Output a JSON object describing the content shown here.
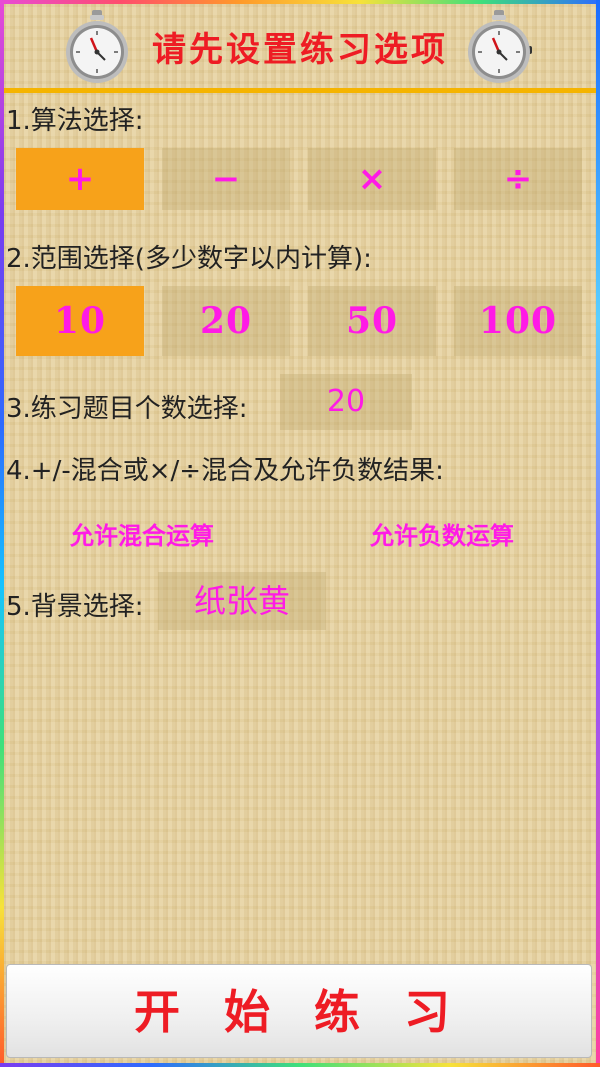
{
  "header": {
    "title": "请先设置练习选项",
    "left_icon": "stopwatch-icon",
    "right_icon": "stopwatch-icon"
  },
  "sections": {
    "operation": {
      "label": "1.算法选择:",
      "options": [
        "+",
        "−",
        "×",
        "÷"
      ],
      "selected": "+"
    },
    "range": {
      "label": "2.范围选择(多少数字以内计算):",
      "options": [
        "10",
        "20",
        "50",
        "100"
      ],
      "selected": "10"
    },
    "count": {
      "label": "3.练习题目个数选择:",
      "value": "20"
    },
    "mixed": {
      "label": "4.+/-混合或×/÷混合及允许负数结果:",
      "allow_mixed": "允许混合运算",
      "allow_negative": "允许负数运算"
    },
    "background": {
      "label": "5.背景选择:",
      "value": "纸张黄"
    }
  },
  "start_button": "开 始 练 习",
  "colors": {
    "title": "#ee1c24",
    "accent_text": "#ff1ae6",
    "selected_bg": "#f7a21a",
    "header_line": "#f5b400"
  }
}
